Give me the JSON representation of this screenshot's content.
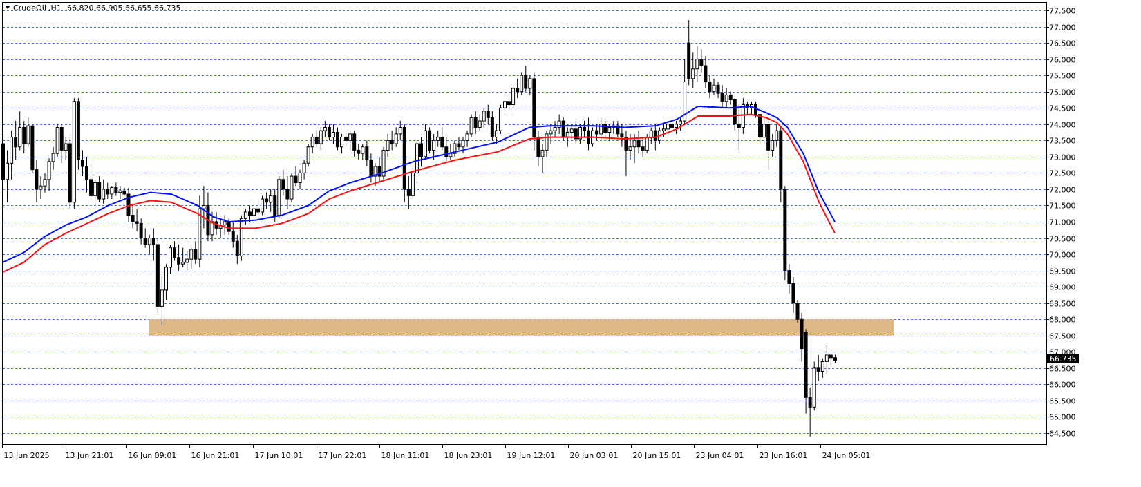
{
  "header": {
    "symbol": "CrudeOIL,H1",
    "ohlc": "66.820 66.905 66.655 66.735"
  },
  "colors": {
    "ma_fast": "#0010ff",
    "ma_slow": "#ff1010",
    "zone": "#deb887",
    "grid": "#2a4fd6",
    "candle": "#000000",
    "background": "#ffffff"
  },
  "chart_data": {
    "type": "candlestick",
    "symbol": "CrudeOIL",
    "timeframe": "H1",
    "last_price": "66.735",
    "grid": true,
    "y_ticks": [
      "77.500",
      "77.000",
      "76.500",
      "76.000",
      "75.500",
      "75.000",
      "74.500",
      "74.000",
      "73.500",
      "73.000",
      "72.500",
      "72.000",
      "71.500",
      "71.000",
      "70.500",
      "70.000",
      "69.500",
      "69.000",
      "68.500",
      "68.000",
      "67.500",
      "67.000",
      "66.500",
      "66.000",
      "65.500",
      "65.000",
      "64.500"
    ],
    "x_ticks": [
      "13 Jun 2025",
      "13 Jun 21:01",
      "16 Jun 09:01",
      "16 Jun 21:01",
      "17 Jun 10:01",
      "17 Jun 22:01",
      "18 Jun 11:01",
      "18 Jun 23:01",
      "19 Jun 12:01",
      "20 Jun 03:01",
      "20 Jun 15:01",
      "23 Jun 04:01",
      "23 Jun 16:01",
      "24 Jun 05:01"
    ],
    "support_zone": {
      "low": 67.5,
      "high": 68.0
    },
    "candles": [
      [
        73.4,
        73.7,
        71.1,
        72.3
      ],
      [
        72.3,
        73.2,
        71.6,
        72.8
      ],
      [
        72.8,
        73.8,
        72.3,
        73.6
      ],
      [
        73.6,
        74.1,
        72.9,
        73.3
      ],
      [
        73.3,
        74.4,
        73.2,
        73.9
      ],
      [
        73.9,
        74.1,
        73.1,
        73.4
      ],
      [
        73.4,
        74.2,
        73.3,
        73.95
      ],
      [
        73.95,
        74.0,
        72.5,
        72.6
      ],
      [
        72.6,
        72.9,
        71.6,
        72.0
      ],
      [
        72.0,
        72.4,
        71.7,
        72.1
      ],
      [
        72.1,
        72.5,
        71.9,
        72.3
      ],
      [
        72.3,
        72.95,
        71.95,
        72.85
      ],
      [
        72.85,
        73.3,
        72.6,
        73.1
      ],
      [
        73.1,
        74.0,
        73.0,
        73.9
      ],
      [
        73.9,
        74.0,
        72.8,
        73.2
      ],
      [
        73.2,
        73.6,
        72.9,
        73.4
      ],
      [
        73.4,
        73.6,
        71.4,
        71.6
      ],
      [
        71.6,
        74.8,
        71.4,
        74.7
      ],
      [
        74.7,
        74.8,
        72.6,
        72.9
      ],
      [
        72.9,
        73.2,
        72.4,
        72.7
      ],
      [
        72.7,
        73.0,
        71.9,
        72.3
      ],
      [
        72.3,
        72.8,
        71.6,
        71.8
      ],
      [
        71.8,
        72.3,
        71.5,
        72.2
      ],
      [
        72.2,
        72.4,
        71.6,
        71.7
      ],
      [
        71.7,
        72.3,
        71.55,
        72.0
      ],
      [
        72.0,
        72.2,
        71.7,
        71.85
      ],
      [
        71.85,
        72.1,
        71.7,
        72.05
      ],
      [
        72.05,
        72.2,
        71.8,
        71.9
      ],
      [
        71.9,
        72.1,
        71.7,
        71.95
      ],
      [
        71.95,
        72.05,
        71.8,
        71.85
      ],
      [
        71.85,
        72.05,
        71.0,
        71.2
      ],
      [
        71.2,
        71.5,
        70.8,
        71.0
      ],
      [
        71.0,
        71.4,
        70.7,
        70.95
      ],
      [
        70.95,
        71.1,
        70.3,
        70.5
      ],
      [
        70.5,
        70.8,
        70.2,
        70.3
      ],
      [
        70.3,
        70.6,
        70.0,
        70.5
      ],
      [
        70.5,
        70.8,
        69.8,
        70.3
      ],
      [
        70.3,
        70.5,
        68.2,
        68.4
      ],
      [
        68.4,
        69.4,
        67.8,
        68.9
      ],
      [
        68.9,
        69.7,
        68.6,
        69.6
      ],
      [
        69.6,
        70.3,
        69.4,
        70.2
      ],
      [
        70.2,
        70.4,
        69.8,
        69.9
      ],
      [
        69.9,
        70.3,
        69.5,
        69.7
      ],
      [
        69.7,
        70.2,
        69.6,
        69.75
      ],
      [
        69.75,
        70.1,
        69.5,
        69.85
      ],
      [
        69.85,
        70.2,
        69.55,
        70.15
      ],
      [
        70.15,
        70.4,
        69.7,
        69.85
      ],
      [
        69.85,
        71.8,
        69.6,
        71.4
      ],
      [
        71.4,
        72.1,
        70.8,
        71.5
      ],
      [
        71.5,
        71.9,
        70.4,
        70.6
      ],
      [
        70.6,
        71.3,
        70.4,
        71.0
      ],
      [
        71.0,
        71.3,
        70.6,
        70.8
      ],
      [
        70.8,
        71.1,
        70.5,
        70.9
      ],
      [
        70.9,
        71.2,
        70.6,
        71.0
      ],
      [
        71.0,
        71.1,
        70.6,
        70.7
      ],
      [
        70.7,
        71.0,
        70.2,
        70.4
      ],
      [
        70.4,
        70.6,
        69.7,
        69.95
      ],
      [
        69.95,
        71.2,
        69.8,
        71.1
      ],
      [
        71.1,
        71.4,
        70.9,
        71.3
      ],
      [
        71.3,
        71.5,
        71.0,
        71.2
      ],
      [
        71.2,
        71.6,
        71.0,
        71.4
      ],
      [
        71.4,
        71.7,
        71.1,
        71.3
      ],
      [
        71.3,
        71.8,
        71.2,
        71.7
      ],
      [
        71.7,
        71.9,
        71.4,
        71.6
      ],
      [
        71.6,
        72.0,
        71.3,
        71.8
      ],
      [
        71.8,
        72.0,
        71.0,
        71.2
      ],
      [
        71.2,
        72.4,
        71.1,
        72.3
      ],
      [
        72.3,
        72.6,
        71.8,
        72.0
      ],
      [
        72.0,
        72.4,
        71.4,
        71.7
      ],
      [
        71.7,
        72.5,
        71.6,
        72.4
      ],
      [
        72.4,
        72.7,
        72.1,
        72.2
      ],
      [
        72.2,
        72.6,
        72.0,
        72.5
      ],
      [
        72.5,
        72.9,
        72.3,
        72.8
      ],
      [
        72.8,
        73.4,
        72.7,
        73.3
      ],
      [
        73.3,
        73.7,
        73.1,
        73.6
      ],
      [
        73.6,
        73.8,
        73.3,
        73.4
      ],
      [
        73.4,
        73.9,
        73.2,
        73.8
      ],
      [
        73.8,
        74.1,
        73.6,
        73.9
      ],
      [
        73.9,
        74.0,
        73.5,
        73.6
      ],
      [
        73.6,
        74.0,
        73.4,
        73.75
      ],
      [
        73.75,
        73.9,
        73.2,
        73.3
      ],
      [
        73.3,
        73.7,
        73.1,
        73.6
      ],
      [
        73.6,
        73.8,
        73.3,
        73.5
      ],
      [
        73.5,
        73.8,
        73.2,
        73.7
      ],
      [
        73.7,
        73.8,
        73.0,
        73.2
      ],
      [
        73.2,
        73.4,
        72.9,
        73.1
      ],
      [
        73.1,
        73.4,
        72.9,
        73.3
      ],
      [
        73.3,
        73.5,
        72.7,
        72.9
      ],
      [
        72.9,
        73.1,
        72.2,
        72.4
      ],
      [
        72.4,
        72.8,
        72.1,
        72.7
      ],
      [
        72.7,
        73.0,
        72.2,
        72.4
      ],
      [
        72.4,
        73.3,
        72.3,
        73.2
      ],
      [
        73.2,
        73.7,
        73.0,
        73.5
      ],
      [
        73.5,
        73.8,
        73.2,
        73.4
      ],
      [
        73.4,
        73.9,
        73.3,
        73.7
      ],
      [
        73.7,
        74.1,
        73.5,
        73.9
      ],
      [
        73.9,
        74.0,
        71.6,
        72.0
      ],
      [
        72.0,
        72.4,
        71.4,
        71.8
      ],
      [
        71.8,
        72.7,
        71.7,
        72.5
      ],
      [
        72.5,
        73.5,
        72.2,
        73.4
      ],
      [
        73.4,
        73.6,
        72.7,
        73.0
      ],
      [
        73.0,
        74.0,
        72.9,
        73.8
      ],
      [
        73.8,
        73.9,
        73.1,
        73.2
      ],
      [
        73.2,
        73.7,
        72.9,
        73.5
      ],
      [
        73.5,
        73.8,
        73.3,
        73.6
      ],
      [
        73.6,
        73.9,
        73.2,
        73.3
      ],
      [
        73.3,
        73.6,
        72.8,
        73.0
      ],
      [
        73.0,
        73.4,
        72.9,
        73.1
      ],
      [
        73.1,
        73.5,
        73.0,
        73.4
      ],
      [
        73.4,
        73.6,
        73.2,
        73.3
      ],
      [
        73.3,
        73.6,
        73.1,
        73.5
      ],
      [
        73.5,
        73.8,
        73.3,
        73.7
      ],
      [
        73.7,
        74.3,
        73.6,
        74.2
      ],
      [
        74.2,
        74.4,
        73.7,
        73.9
      ],
      [
        73.9,
        74.3,
        73.8,
        74.1
      ],
      [
        74.1,
        74.5,
        73.9,
        74.4
      ],
      [
        74.4,
        74.6,
        74.0,
        74.2
      ],
      [
        74.2,
        74.4,
        73.5,
        73.6
      ],
      [
        73.6,
        74.0,
        73.4,
        73.8
      ],
      [
        73.8,
        74.6,
        73.7,
        74.5
      ],
      [
        74.5,
        74.8,
        74.3,
        74.7
      ],
      [
        74.7,
        75.0,
        74.4,
        74.6
      ],
      [
        74.6,
        75.2,
        74.5,
        75.1
      ],
      [
        75.1,
        75.4,
        74.8,
        75.0
      ],
      [
        75.0,
        75.6,
        74.9,
        75.5
      ],
      [
        75.5,
        75.8,
        75.0,
        75.1
      ],
      [
        75.1,
        75.5,
        74.9,
        75.4
      ],
      [
        75.4,
        75.6,
        73.2,
        73.6
      ],
      [
        73.6,
        73.8,
        72.7,
        73.0
      ],
      [
        73.0,
        73.4,
        72.5,
        73.2
      ],
      [
        73.2,
        73.8,
        73.0,
        73.7
      ],
      [
        73.7,
        74.0,
        73.4,
        73.8
      ],
      [
        73.8,
        74.1,
        73.6,
        73.9
      ],
      [
        73.9,
        74.3,
        73.7,
        74.1
      ],
      [
        74.1,
        74.2,
        73.5,
        73.6
      ],
      [
        73.6,
        73.9,
        73.3,
        73.75
      ],
      [
        73.75,
        74.0,
        73.5,
        73.85
      ],
      [
        73.85,
        74.1,
        73.4,
        73.55
      ],
      [
        73.55,
        74.0,
        73.4,
        73.9
      ],
      [
        73.9,
        74.1,
        73.6,
        73.8
      ],
      [
        73.8,
        74.2,
        73.2,
        73.4
      ],
      [
        73.4,
        73.9,
        73.3,
        73.8
      ],
      [
        73.8,
        74.0,
        73.5,
        73.7
      ],
      [
        73.7,
        74.2,
        73.5,
        74.0
      ],
      [
        74.0,
        74.1,
        73.6,
        73.75
      ],
      [
        73.75,
        74.0,
        73.5,
        73.9
      ],
      [
        73.9,
        74.1,
        73.7,
        73.95
      ],
      [
        73.95,
        74.1,
        73.6,
        73.7
      ],
      [
        73.7,
        74.0,
        73.3,
        73.6
      ],
      [
        73.6,
        73.8,
        72.4,
        73.2
      ],
      [
        73.2,
        73.7,
        72.9,
        73.3
      ],
      [
        73.3,
        73.7,
        72.8,
        73.5
      ],
      [
        73.5,
        73.8,
        73.1,
        73.3
      ],
      [
        73.3,
        73.6,
        73.0,
        73.2
      ],
      [
        73.2,
        73.7,
        73.1,
        73.6
      ],
      [
        73.6,
        73.9,
        73.4,
        73.8
      ],
      [
        73.8,
        74.0,
        73.2,
        73.5
      ],
      [
        73.5,
        73.9,
        73.4,
        73.8
      ],
      [
        73.8,
        74.0,
        73.6,
        73.85
      ],
      [
        73.85,
        74.1,
        73.7,
        74.0
      ],
      [
        74.0,
        74.2,
        73.8,
        73.9
      ],
      [
        73.9,
        74.1,
        73.7,
        74.0
      ],
      [
        74.0,
        74.2,
        73.8,
        74.1
      ],
      [
        74.1,
        76.0,
        74.0,
        75.3
      ],
      [
        76.5,
        77.2,
        75.2,
        75.4
      ],
      [
        75.4,
        76.2,
        75.1,
        75.7
      ],
      [
        75.7,
        76.4,
        75.3,
        76.0
      ],
      [
        76.0,
        76.3,
        75.6,
        75.8
      ],
      [
        75.8,
        76.1,
        75.1,
        75.3
      ],
      [
        75.3,
        75.5,
        74.8,
        75.0
      ],
      [
        75.0,
        75.4,
        74.9,
        75.2
      ],
      [
        75.2,
        75.3,
        74.8,
        74.95
      ],
      [
        74.95,
        75.2,
        74.5,
        74.7
      ],
      [
        74.7,
        75.1,
        74.5,
        74.9
      ],
      [
        74.9,
        75.0,
        74.6,
        74.75
      ],
      [
        74.75,
        74.8,
        73.8,
        74.0
      ],
      [
        74.0,
        74.6,
        73.2,
        73.9
      ],
      [
        73.9,
        74.8,
        73.7,
        74.6
      ],
      [
        74.6,
        74.7,
        74.3,
        74.5
      ],
      [
        74.5,
        74.7,
        74.3,
        74.6
      ],
      [
        74.6,
        74.7,
        74.2,
        74.3
      ],
      [
        74.3,
        74.5,
        73.4,
        73.6
      ],
      [
        73.6,
        74.2,
        73.4,
        74.0
      ],
      [
        74.0,
        74.1,
        72.6,
        73.2
      ],
      [
        73.2,
        73.7,
        73.0,
        73.5
      ],
      [
        73.5,
        74.0,
        73.3,
        73.8
      ],
      [
        73.8,
        73.9,
        71.6,
        72.0
      ],
      [
        72.0,
        72.1,
        69.2,
        69.5
      ],
      [
        69.5,
        69.7,
        68.8,
        69.1
      ],
      [
        69.1,
        69.3,
        68.2,
        68.5
      ],
      [
        68.5,
        68.6,
        67.9,
        68.0
      ],
      [
        68.0,
        68.2,
        66.7,
        67.1
      ],
      [
        67.6,
        67.7,
        65.1,
        65.6
      ],
      [
        65.6,
        65.9,
        64.4,
        65.3
      ],
      [
        65.3,
        66.7,
        65.2,
        66.5
      ],
      [
        66.5,
        66.9,
        66.1,
        66.4
      ],
      [
        66.4,
        66.8,
        66.2,
        66.7
      ],
      [
        66.7,
        67.2,
        66.3,
        66.9
      ],
      [
        66.9,
        67.0,
        66.6,
        66.82
      ],
      [
        66.82,
        66.91,
        66.66,
        66.74
      ]
    ],
    "ma_fast": [
      [
        0,
        69.75
      ],
      [
        0.0198,
        70.05
      ],
      [
        0.04,
        70.55
      ],
      [
        0.06,
        70.9
      ],
      [
        0.08,
        71.15
      ],
      [
        0.1,
        71.5
      ],
      [
        0.12,
        71.75
      ],
      [
        0.14,
        71.9
      ],
      [
        0.16,
        71.85
      ],
      [
        0.185,
        71.5
      ],
      [
        0.2,
        71.15
      ],
      [
        0.215,
        71.0
      ],
      [
        0.24,
        71.05
      ],
      [
        0.265,
        71.2
      ],
      [
        0.29,
        71.5
      ],
      [
        0.31,
        71.95
      ],
      [
        0.33,
        72.2
      ],
      [
        0.36,
        72.5
      ],
      [
        0.39,
        72.85
      ],
      [
        0.43,
        73.15
      ],
      [
        0.47,
        73.45
      ],
      [
        0.5,
        73.9
      ],
      [
        0.52,
        73.95
      ],
      [
        0.56,
        73.95
      ],
      [
        0.59,
        73.9
      ],
      [
        0.62,
        73.95
      ],
      [
        0.64,
        74.15
      ],
      [
        0.66,
        74.55
      ],
      [
        0.69,
        74.5
      ],
      [
        0.71,
        74.55
      ],
      [
        0.725,
        74.35
      ],
      [
        0.735,
        74.2
      ],
      [
        0.745,
        73.9
      ],
      [
        0.76,
        73.1
      ],
      [
        0.775,
        71.9
      ],
      [
        0.79,
        71.0
      ]
    ],
    "ma_slow": [
      [
        0,
        69.45
      ],
      [
        0.02,
        69.75
      ],
      [
        0.04,
        70.3
      ],
      [
        0.06,
        70.65
      ],
      [
        0.08,
        70.95
      ],
      [
        0.1,
        71.25
      ],
      [
        0.12,
        71.5
      ],
      [
        0.14,
        71.65
      ],
      [
        0.16,
        71.6
      ],
      [
        0.185,
        71.25
      ],
      [
        0.2,
        70.95
      ],
      [
        0.215,
        70.8
      ],
      [
        0.24,
        70.8
      ],
      [
        0.265,
        70.95
      ],
      [
        0.29,
        71.25
      ],
      [
        0.31,
        71.7
      ],
      [
        0.33,
        71.95
      ],
      [
        0.36,
        72.25
      ],
      [
        0.39,
        72.55
      ],
      [
        0.43,
        72.9
      ],
      [
        0.47,
        73.15
      ],
      [
        0.5,
        73.55
      ],
      [
        0.52,
        73.6
      ],
      [
        0.56,
        73.6
      ],
      [
        0.59,
        73.55
      ],
      [
        0.62,
        73.6
      ],
      [
        0.64,
        73.85
      ],
      [
        0.66,
        74.25
      ],
      [
        0.69,
        74.25
      ],
      [
        0.71,
        74.3
      ],
      [
        0.725,
        74.2
      ],
      [
        0.735,
        74.05
      ],
      [
        0.745,
        73.7
      ],
      [
        0.76,
        72.85
      ],
      [
        0.775,
        71.6
      ],
      [
        0.79,
        70.65
      ]
    ]
  }
}
